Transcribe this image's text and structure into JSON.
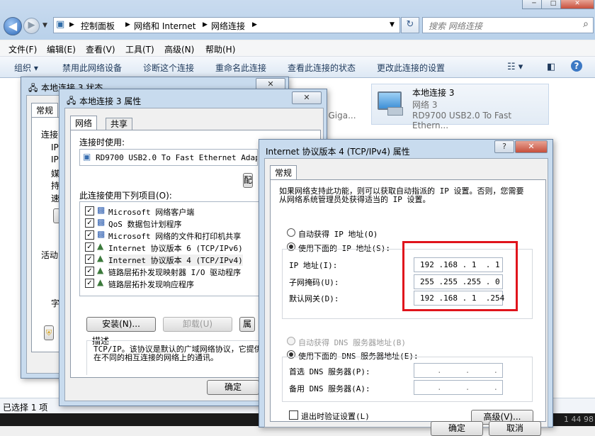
{
  "window_controls": {
    "minimize": "─",
    "maximize": "□",
    "close": "✕"
  },
  "address": {
    "crumbs": [
      "控制面板",
      "网络和 Internet",
      "网络连接"
    ],
    "search_placeholder": "搜索 网络连接"
  },
  "menu": [
    "文件(F)",
    "编辑(E)",
    "查看(V)",
    "工具(T)",
    "高级(N)",
    "帮助(H)"
  ],
  "commands": [
    "组织 ▾",
    "禁用此网络设备",
    "诊断这个连接",
    "重命名此连接",
    "查看此连接的状态",
    "更改此连接的设置"
  ],
  "adapter_tile": {
    "name": "本地连接 3",
    "network": "网络 3",
    "device": "RD9700 USB2.0 To Fast Ethern..."
  },
  "background_partial_text": ") Giga...",
  "status_bar": {
    "text": "已选择 1 项",
    "right_text": "1 44 98"
  },
  "status_dialog": {
    "title": "本地连接 3 状态",
    "tab": "常规",
    "labels": [
      "连接",
      "IP",
      "IP",
      "媒",
      "持",
      "速"
    ],
    "activity_label": "活动",
    "bottom_label": "字"
  },
  "properties_dialog": {
    "title": "本地连接 3 属性",
    "tabs": [
      "网络",
      "共享"
    ],
    "connect_using_label": "连接时使用:",
    "adapter_name": "RD9700 USB2.0 To Fast Ethernet Adapte",
    "configure_button": "配",
    "items_label": "此连接使用下列项目(O):",
    "items": [
      {
        "label": "Microsoft 网络客户端",
        "checked": true,
        "icon": "network-client-icon"
      },
      {
        "label": "QoS 数据包计划程序",
        "checked": true,
        "icon": "qos-icon"
      },
      {
        "label": "Microsoft 网络的文件和打印机共享",
        "checked": true,
        "icon": "file-share-icon"
      },
      {
        "label": "Internet 协议版本 6 (TCP/IPv6)",
        "checked": true,
        "icon": "protocol-icon"
      },
      {
        "label": "Internet 协议版本 4 (TCP/IPv4)",
        "checked": true,
        "icon": "protocol-icon"
      },
      {
        "label": "链路层拓扑发现映射器 I/O 驱动程序",
        "checked": true,
        "icon": "protocol-icon"
      },
      {
        "label": "链路层拓扑发现响应程序",
        "checked": true,
        "icon": "protocol-icon"
      }
    ],
    "install_button": "安装(N)...",
    "uninstall_button": "卸载(U)",
    "properties_button": "属",
    "description_label": "描述",
    "description": "TCP/IP。该协议是默认的广域网络协议，它提供在不同的相互连接的网络上的通讯。",
    "ok_button": "确定"
  },
  "ipv4_dialog": {
    "title": "Internet 协议版本 4 (TCP/IPv4) 属性",
    "help": "?",
    "tab": "常规",
    "intro": "如果网络支持此功能，则可以获取自动指派的 IP 设置。否则，您需要从网络系统管理员处获得适当的 IP 设置。",
    "auto_ip_label": "自动获得 IP 地址(O)",
    "manual_ip_label": "使用下面的 IP 地址(S):",
    "ip_address_label": "IP 地址(I):",
    "ip_address": "192 .168 . 1  . 1",
    "subnet_label": "子网掩码(U):",
    "subnet": "255 .255 .255 . 0",
    "gateway_label": "默认网关(D):",
    "gateway": "192 .168 . 1  .254",
    "auto_dns_label": "自动获得 DNS 服务器地址(B)",
    "manual_dns_label": "使用下面的 DNS 服务器地址(E):",
    "preferred_dns_label": "首选 DNS 服务器(P):",
    "preferred_dns": ".     .     .",
    "alternate_dns_label": "备用 DNS 服务器(A):",
    "alternate_dns": ".     .     .",
    "validate_label": "退出时验证设置(L)",
    "advanced_button": "高级(V)...",
    "ok_button": "确定",
    "cancel_button": "取消",
    "ip_selection": "manual",
    "dns_selection": "manual",
    "validate_checked": false
  },
  "colors": {
    "highlight_box": "#e0141c",
    "title_glass": "#c8dbee"
  }
}
